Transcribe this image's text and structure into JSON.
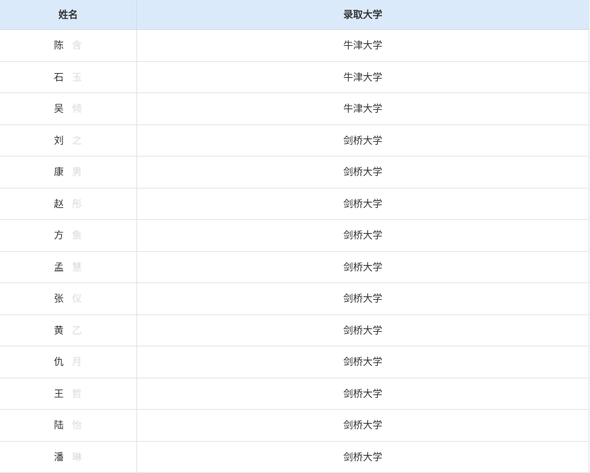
{
  "table": {
    "headers": {
      "name": "姓名",
      "university": "录取大学"
    },
    "rows": [
      {
        "surname": "陈",
        "given_last": "含",
        "university": "牛津大学"
      },
      {
        "surname": "石",
        "given_last": "玉",
        "university": "牛津大学"
      },
      {
        "surname": "吴",
        "given_last": "倾",
        "university": "牛津大学"
      },
      {
        "surname": "刘",
        "given_last": "之",
        "university": "剑桥大学"
      },
      {
        "surname": "康",
        "given_last": "男",
        "university": "剑桥大学"
      },
      {
        "surname": "赵",
        "given_last": "彤",
        "university": "剑桥大学"
      },
      {
        "surname": "方",
        "given_last": "鱼",
        "university": "剑桥大学"
      },
      {
        "surname": "孟",
        "given_last": "慧",
        "university": "剑桥大学"
      },
      {
        "surname": "张",
        "given_last": "仪",
        "university": "剑桥大学"
      },
      {
        "surname": "黄",
        "given_last": "乙",
        "university": "剑桥大学"
      },
      {
        "surname": "仇",
        "given_last": "月",
        "university": "剑桥大学"
      },
      {
        "surname": "王",
        "given_last": "哲",
        "university": "剑桥大学"
      },
      {
        "surname": "陆",
        "given_last": "怡",
        "university": "剑桥大学"
      },
      {
        "surname": "潘",
        "given_last": "琳",
        "university": "剑桥大学"
      }
    ]
  }
}
